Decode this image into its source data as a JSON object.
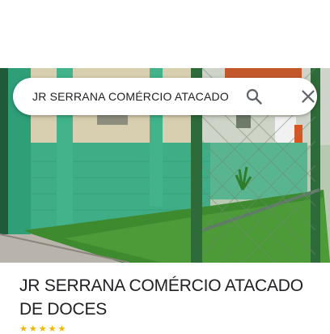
{
  "search": {
    "query": "JR SERRANA COMÉRCIO ATACADO"
  },
  "place": {
    "title": "JR SERRANA COMÉRCIO ATACADO DE DOCES"
  },
  "icons": {
    "search": "search-icon",
    "close": "close-icon"
  },
  "colors": {
    "wall_green": "#3fae87",
    "wall_cream": "#d8cfb0",
    "grass": "#3e8a2f",
    "fence_post": "#2e6b3a",
    "accent_text": "#202124"
  }
}
